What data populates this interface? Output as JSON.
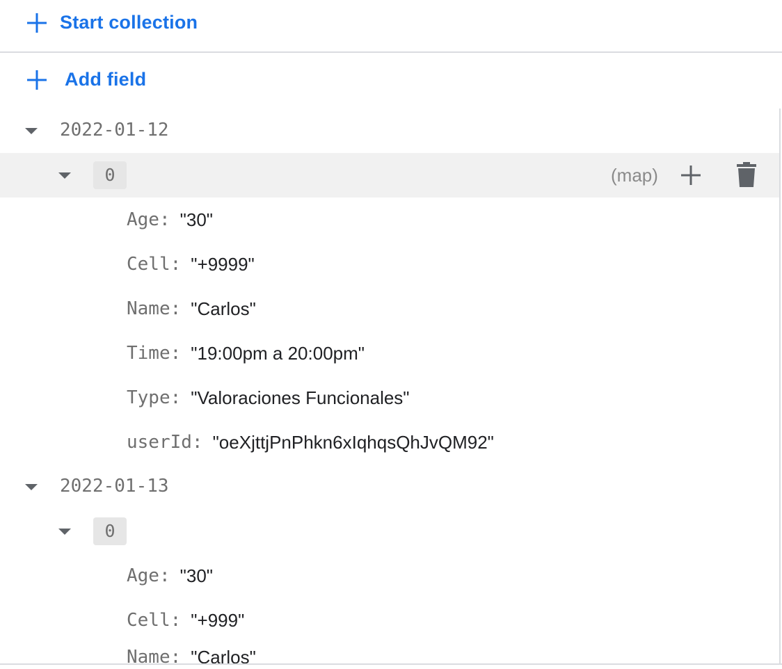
{
  "toolbar": {
    "start_collection_label": "Start collection",
    "add_field_label": "Add field"
  },
  "colors": {
    "accent": "#1a73e8",
    "highlight_row": "#f1f1f1",
    "chip": "#e6e6e6"
  },
  "entries": [
    {
      "date": "2022-01-12",
      "index": "0",
      "type": "(map)",
      "fields": [
        {
          "key": "Age:",
          "value": "\"30\""
        },
        {
          "key": "Cell:",
          "value": "\"+9999\""
        },
        {
          "key": "Name:",
          "value": "\"Carlos\""
        },
        {
          "key": "Time:",
          "value": "\"19:00pm a 20:00pm\""
        },
        {
          "key": "Type:",
          "value": "\"Valoraciones Funcionales\""
        },
        {
          "key": "userId:",
          "value": "\"oeXjttjPnPhkn6xIqhqsQhJvQM92\""
        }
      ]
    },
    {
      "date": "2022-01-13",
      "index": "0",
      "fields": [
        {
          "key": "Age:",
          "value": "\"30\""
        },
        {
          "key": "Cell:",
          "value": "\"+999\""
        },
        {
          "key": "Name:",
          "value": "\"Carlos\""
        }
      ]
    }
  ],
  "icons": [
    "plus-icon",
    "caret-down-icon",
    "add-icon",
    "trash-icon"
  ]
}
